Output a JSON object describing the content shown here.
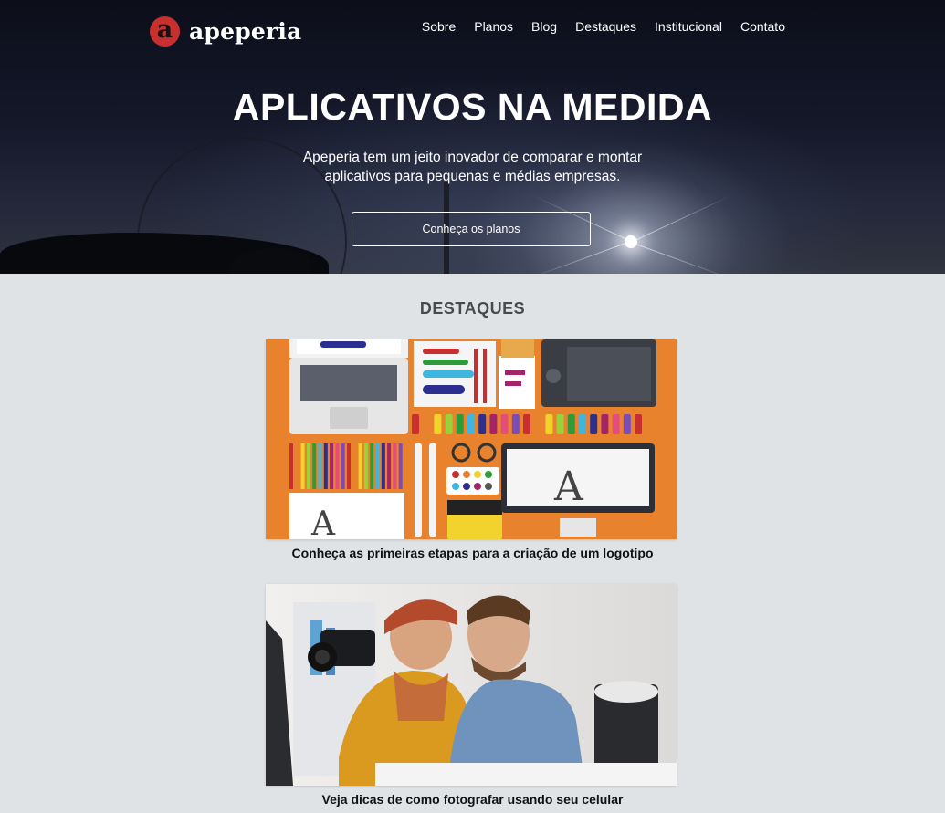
{
  "brand": {
    "mark": "a",
    "name": "apeperia",
    "mark_color": "#c7302f"
  },
  "nav": {
    "items": [
      "Sobre",
      "Planos",
      "Blog",
      "Destaques",
      "Institucional",
      "Contato"
    ]
  },
  "hero": {
    "title": "APLICATIVOS NA MEDIDA",
    "subtitle_line1": "Apeperia tem um jeito inovador de comparar e montar",
    "subtitle_line2": "aplicativos para pequenas e médias empresas.",
    "cta": "Conheça os planos"
  },
  "destaques": {
    "title": "DESTAQUES",
    "cards": [
      {
        "caption": "Conheça as primeiras etapas para a criação de um logotipo",
        "image": "design-tools-illustration"
      },
      {
        "caption": "Veja dicas de como fotografar usando seu celular",
        "image": "photographers-with-camera-photo"
      }
    ]
  },
  "colors": {
    "page_bg": "#e0e3e6",
    "card1_bg": "#e8822d",
    "text_dark": "#111111"
  }
}
